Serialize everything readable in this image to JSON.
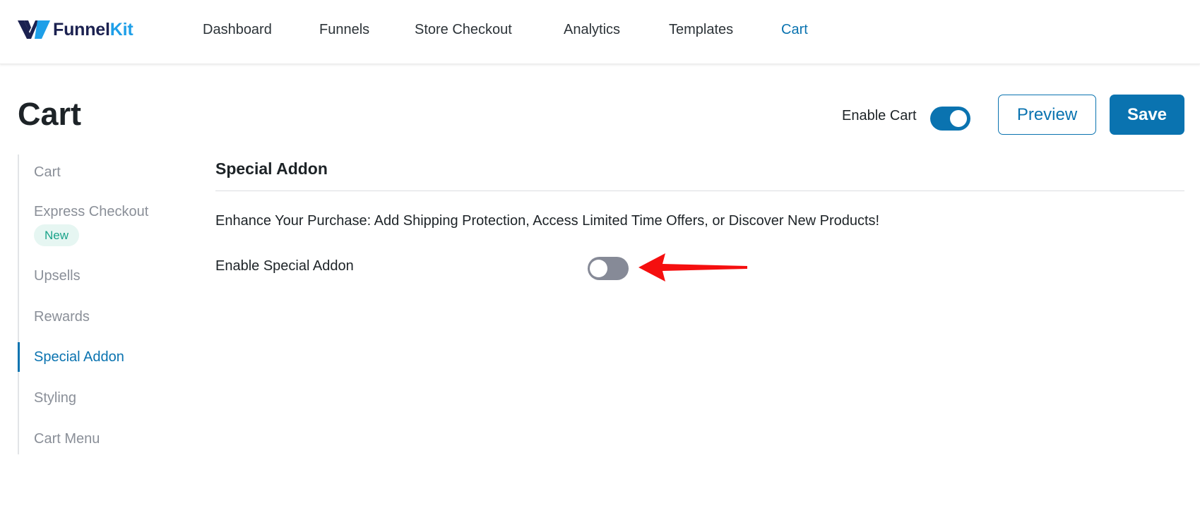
{
  "brand": {
    "name_part1": "Funnel",
    "name_part2": "Kit",
    "primary_color": "#1b2150",
    "accent_color": "#1e9fe8"
  },
  "nav": {
    "items": [
      {
        "label": "Dashboard",
        "active": false
      },
      {
        "label": "Funnels",
        "active": false
      },
      {
        "label": "Store Checkout",
        "active": false
      },
      {
        "label": "Analytics",
        "active": false
      },
      {
        "label": "Templates",
        "active": false
      },
      {
        "label": "Cart",
        "active": true
      }
    ]
  },
  "header": {
    "title": "Cart",
    "enable_cart_label": "Enable Cart",
    "enable_cart_on": true,
    "preview_label": "Preview",
    "save_label": "Save"
  },
  "sidebar": {
    "items": [
      {
        "label": "Cart",
        "active": false
      },
      {
        "label": "Express Checkout",
        "active": false,
        "badge": "New"
      },
      {
        "label": "Upsells",
        "active": false
      },
      {
        "label": "Rewards",
        "active": false
      },
      {
        "label": "Special Addon",
        "active": true
      },
      {
        "label": "Styling",
        "active": false
      },
      {
        "label": "Cart Menu",
        "active": false
      }
    ]
  },
  "section": {
    "title": "Special Addon",
    "description": "Enhance Your Purchase: Add Shipping Protection, Access Limited Time Offers, or Discover New Products!",
    "enable_label": "Enable Special Addon",
    "enable_on": false
  },
  "colors": {
    "link_blue": "#0a73b0",
    "toggle_off": "#868a97",
    "annotation_arrow": "#f50f0f",
    "badge_bg": "#e6f6f2",
    "badge_text": "#1aa38a"
  }
}
